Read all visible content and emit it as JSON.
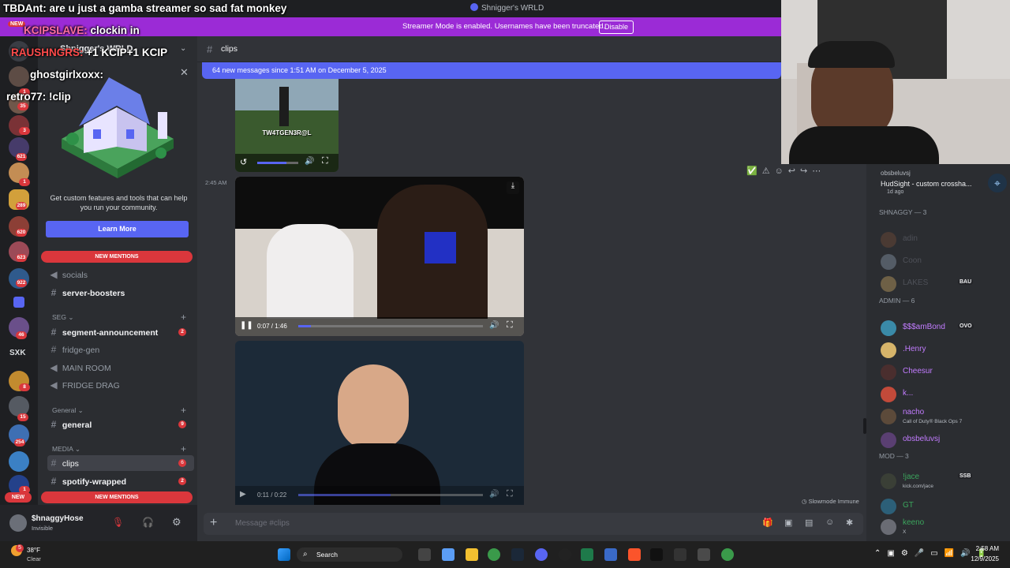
{
  "window": {
    "title": "Shnigger's WRLD"
  },
  "banner": {
    "message": "Streamer Mode is enabled. Usernames have been truncated.",
    "disable_label": "Disable"
  },
  "overlay_chat": [
    {
      "user": "TBDAnt:",
      "text": "are u just a gamba streamer so sad fat monkey"
    },
    {
      "user": "KCIPSLAVE:",
      "text": "clockin in"
    },
    {
      "user": "RAUSHNGRS:",
      "text": "+1 KCIP+1 KCIP"
    },
    {
      "user": "ghostgirlxoxx:",
      "text": ""
    },
    {
      "user": "retro77:",
      "text": "!clip"
    }
  ],
  "overlay_new_label": "NEW",
  "rail": {
    "badges": [
      "26",
      "1",
      "35",
      "3",
      "621",
      "1",
      "289",
      "620",
      "623",
      "922",
      "46",
      "8",
      "15",
      "254",
      "1"
    ],
    "sxk_label": "SXK",
    "new_label": "NEW"
  },
  "server": {
    "name": "Shnigger's WRLD"
  },
  "promo": {
    "text": "Get custom features and tools that can help you run your community.",
    "button": "Learn More"
  },
  "new_mentions": "NEW MENTIONS",
  "channels": {
    "socials": "socials",
    "server_boosters": "server-boosters",
    "seg_category": "SEG",
    "segment_announcement": "segment-announcement",
    "segment_announcement_count": "2",
    "fridge_gen": "fridge-gen",
    "main_room": "MAIN ROOM",
    "fridge_drag": "FRIDGE DRAG",
    "general_category": "General",
    "general": "general",
    "general_count": "9",
    "media_category": "MEDIA",
    "clips": "clips",
    "clips_count": "6",
    "spotify_wrapped": "spotify-wrapped",
    "spotify_wrapped_count": "2"
  },
  "user": {
    "name": "$hnaggyHose",
    "status": "Invisible"
  },
  "chat": {
    "channel": "clips",
    "new_messages": "64 new messages since 1:51 AM on December 5, 2025",
    "timestamp": "2:45 AM",
    "video1_overlay": "TW4TGEN3R@L",
    "video1_progress": 0.72,
    "video2_time": "0:07 / 1:46",
    "video2_progress": 0.07,
    "video3_time": "0:11 / 0:22",
    "video3_progress": 0.5,
    "slowmode": "Slowmode Immune",
    "composer_placeholder": "Message #clips"
  },
  "members": {
    "activity": {
      "name": "obsbeluvsj",
      "text": "HudSight - custom crossha...",
      "ago": "1d ago"
    },
    "groups": [
      {
        "title": "SHNAGGY — 3",
        "items": [
          {
            "name": "adin",
            "color": "#4e5058",
            "tag": ""
          },
          {
            "name": "Coon",
            "color": "#4e5058",
            "tag": ""
          },
          {
            "name": "LAKES",
            "color": "#4e5058",
            "tag": "BAU"
          }
        ]
      },
      {
        "title": "ADMIN — 6",
        "items": [
          {
            "name": "$$$amBond",
            "color": "#c27cff",
            "tag": "OVO"
          },
          {
            "name": ".Henry",
            "color": "#c27cff",
            "tag": ""
          },
          {
            "name": "Cheesur",
            "color": "#c27cff",
            "tag": ""
          },
          {
            "name": "k...",
            "color": "#c27cff",
            "tag": ""
          },
          {
            "name": "nacho",
            "color": "#c27cff",
            "tag": "",
            "status": "Call of Duty® Black Ops 7"
          },
          {
            "name": "obsbeluvsj",
            "color": "#c27cff",
            "tag": ""
          }
        ]
      },
      {
        "title": "MOD — 3",
        "items": [
          {
            "name": "!jace",
            "color": "#3ba55d",
            "tag": "SSB",
            "status": "kick.com/jace"
          },
          {
            "name": "GT",
            "color": "#3ba55d",
            "tag": ""
          },
          {
            "name": "keeno",
            "color": "#3ba55d",
            "tag": "",
            "status": "X"
          }
        ]
      }
    ]
  },
  "taskbar": {
    "weather_temp": "38°F",
    "weather_desc": "Clear",
    "weather_badge": "5",
    "search": "Search",
    "time": "2:58 AM",
    "date": "12/9/2025"
  },
  "colors": {
    "accent": "#5865f2",
    "danger": "#da373c",
    "streamer_banner": "#9b2bd6"
  }
}
